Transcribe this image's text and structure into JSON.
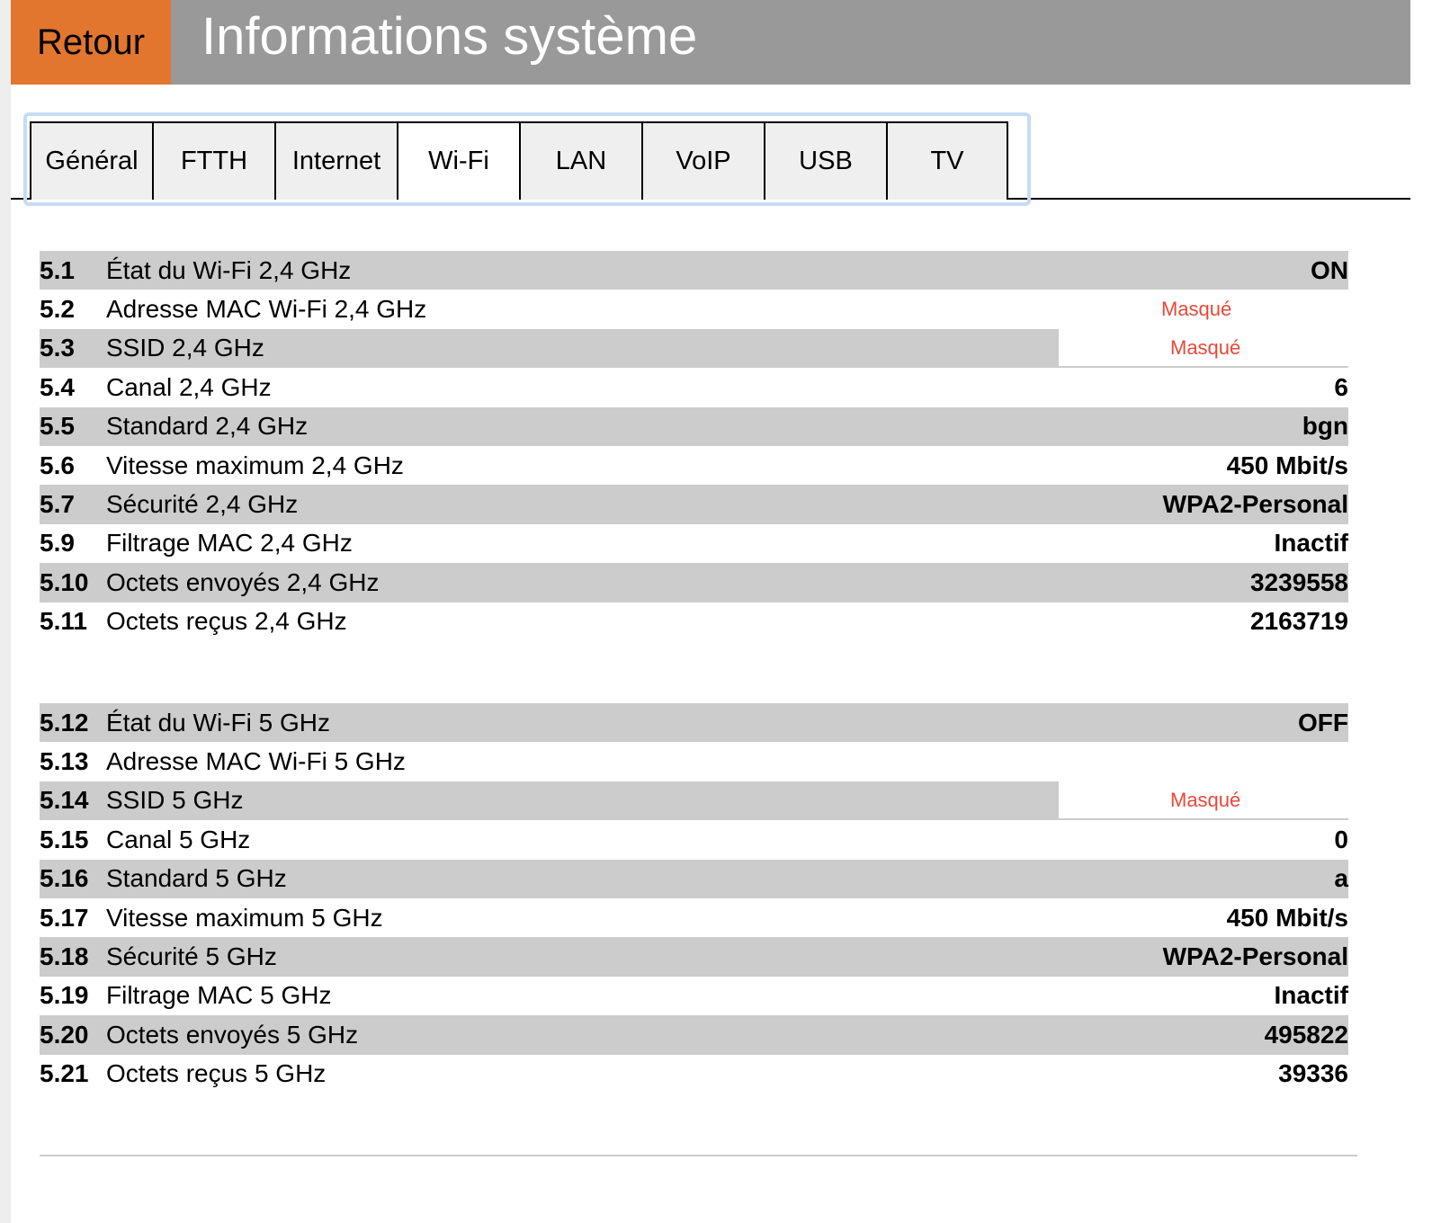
{
  "header": {
    "back_label": "Retour",
    "title": "Informations système"
  },
  "tabs": [
    "Général",
    "FTTH",
    "Internet",
    "Wi-Fi",
    "LAN",
    "VoIP",
    "USB",
    "TV"
  ],
  "active_tab": "Wi-Fi",
  "masked_label": "Masqué",
  "colors": {
    "accent": "#e2762f",
    "header": "#999999",
    "masked": "#e8483a"
  },
  "section1": [
    {
      "num": "5.1",
      "label": "État du Wi-Fi 2,4 GHz",
      "value": "ON"
    },
    {
      "num": "5.2",
      "label": "Adresse MAC Wi-Fi 2,4 GHz",
      "value": "Masqué"
    },
    {
      "num": "5.3",
      "label": "SSID 2,4 GHz",
      "value": "Masqué"
    },
    {
      "num": "5.4",
      "label": "Canal 2,4 GHz",
      "value": "6"
    },
    {
      "num": "5.5",
      "label": "Standard 2,4 GHz",
      "value": "bgn"
    },
    {
      "num": "5.6",
      "label": "Vitesse maximum 2,4 GHz",
      "value": "450 Mbit/s"
    },
    {
      "num": "5.7",
      "label": "Sécurité 2,4 GHz",
      "value": "WPA2-Personal"
    },
    {
      "num": "5.9",
      "label": "Filtrage MAC 2,4 GHz",
      "value": "Inactif"
    },
    {
      "num": "5.10",
      "label": "Octets envoyés 2,4 GHz",
      "value": "3239558"
    },
    {
      "num": "5.11",
      "label": "Octets reçus 2,4 GHz",
      "value": "2163719"
    }
  ],
  "section2": [
    {
      "num": "5.12",
      "label": "État du Wi-Fi 5 GHz",
      "value": "OFF"
    },
    {
      "num": "5.13",
      "label": "Adresse MAC Wi-Fi 5 GHz",
      "value": ""
    },
    {
      "num": "5.14",
      "label": "SSID 5 GHz",
      "value": "Masqué"
    },
    {
      "num": "5.15",
      "label": "Canal 5 GHz",
      "value": "0"
    },
    {
      "num": "5.16",
      "label": "Standard 5 GHz",
      "value": "a"
    },
    {
      "num": "5.17",
      "label": "Vitesse maximum 5 GHz",
      "value": "450 Mbit/s"
    },
    {
      "num": "5.18",
      "label": "Sécurité 5 GHz",
      "value": "WPA2-Personal"
    },
    {
      "num": "5.19",
      "label": "Filtrage MAC 5 GHz",
      "value": "Inactif"
    },
    {
      "num": "5.20",
      "label": "Octets envoyés 5 GHz",
      "value": "495822"
    },
    {
      "num": "5.21",
      "label": "Octets reçus 5 GHz",
      "value": "39336"
    }
  ]
}
